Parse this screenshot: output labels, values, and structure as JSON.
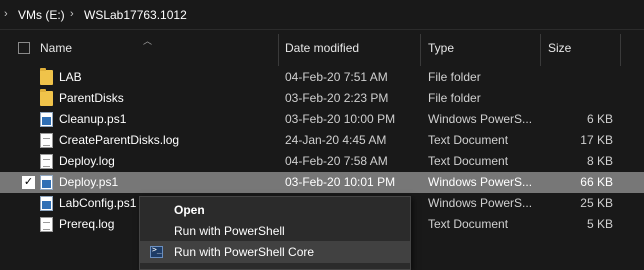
{
  "breadcrumb": {
    "items": [
      "VMs (E:)",
      "WSLab17763.1012"
    ]
  },
  "columns": {
    "name": "Name",
    "date": "Date modified",
    "type": "Type",
    "size": "Size"
  },
  "files": [
    {
      "name": "LAB",
      "date": "04-Feb-20 7:51 AM",
      "type": "File folder",
      "size": "",
      "icon": "folder-icon"
    },
    {
      "name": "ParentDisks",
      "date": "03-Feb-20 2:23 PM",
      "type": "File folder",
      "size": "",
      "icon": "folder-icon"
    },
    {
      "name": "Cleanup.ps1",
      "date": "03-Feb-20 10:00 PM",
      "type": "Windows PowerS...",
      "size": "6 KB",
      "icon": "powershell-script-icon"
    },
    {
      "name": "CreateParentDisks.log",
      "date": "24-Jan-20 4:45 AM",
      "type": "Text Document",
      "size": "17 KB",
      "icon": "text-document-icon"
    },
    {
      "name": "Deploy.log",
      "date": "04-Feb-20 7:58 AM",
      "type": "Text Document",
      "size": "8 KB",
      "icon": "text-document-icon"
    },
    {
      "name": "Deploy.ps1",
      "date": "03-Feb-20 10:01 PM",
      "type": "Windows PowerS...",
      "size": "66 KB",
      "icon": "powershell-script-icon",
      "selected": true
    },
    {
      "name": "LabConfig.ps1",
      "date": "",
      "type": "Windows PowerS...",
      "size": "25 KB",
      "icon": "powershell-script-icon"
    },
    {
      "name": "Prereq.log",
      "date": "",
      "type": "Text Document",
      "size": "5 KB",
      "icon": "text-document-icon"
    }
  ],
  "context_menu": {
    "items": [
      {
        "label": "Open",
        "bold": true
      },
      {
        "label": "Run with PowerShell"
      },
      {
        "label": "Run with PowerShell Core",
        "icon": "powershell-core-icon",
        "hover": true
      }
    ]
  },
  "colors": {
    "background": "#191919",
    "selected_row": "#777777",
    "menu_background": "#2b2b2b",
    "menu_hover": "#414141",
    "folder": "#f0c34a"
  }
}
